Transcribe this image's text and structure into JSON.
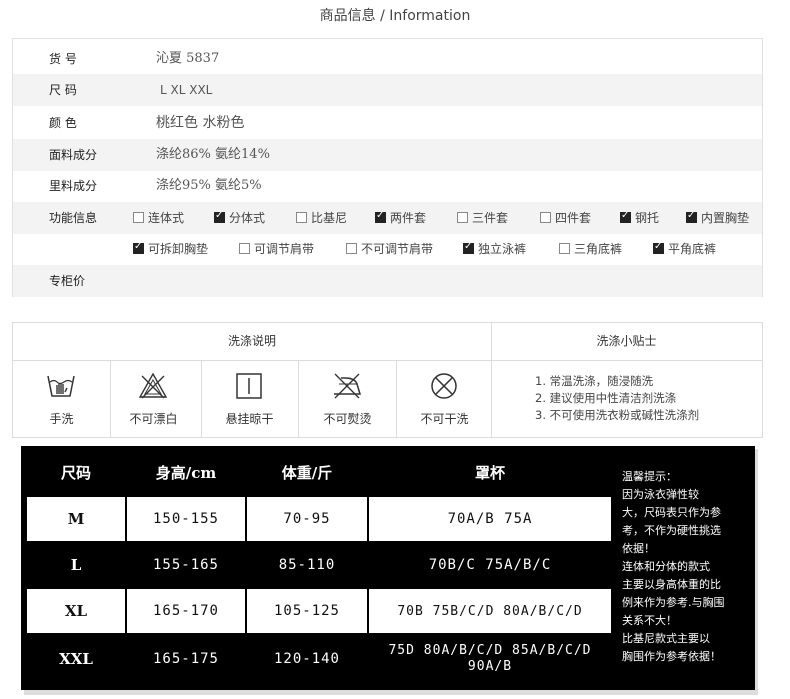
{
  "title": "商品信息 / Information",
  "info": {
    "item_no_label": "货  号",
    "item_no": "沁夏 5837",
    "size_label": "尺  码",
    "sizes": "L    XL    XXL",
    "color_label": "颜  色",
    "colors": "桃红色   水粉色",
    "fabric_label": "面料成分",
    "fabric": "涤纶86%  氨纶14%",
    "lining_label": "里料成分",
    "lining": "涤纶95%  氨纶5%",
    "function_label": "功能信息",
    "functions_row1": [
      {
        "label": "连体式",
        "checked": false
      },
      {
        "label": "分体式",
        "checked": true
      },
      {
        "label": "比基尼",
        "checked": false
      },
      {
        "label": "两件套",
        "checked": true
      },
      {
        "label": "三件套",
        "checked": false
      },
      {
        "label": "四件套",
        "checked": false
      },
      {
        "label": "钢托",
        "checked": true
      },
      {
        "label": "内置胸垫",
        "checked": true
      }
    ],
    "functions_row2": [
      {
        "label": "可拆卸胸垫",
        "checked": true
      },
      {
        "label": "可调节肩带",
        "checked": false
      },
      {
        "label": "不可调节肩带",
        "checked": false
      },
      {
        "label": "独立泳裤",
        "checked": true
      },
      {
        "label": "三角底裤",
        "checked": false
      },
      {
        "label": "平角底裤",
        "checked": true
      }
    ],
    "price_label": "专柜价"
  },
  "wash": {
    "header_left": "洗涤说明",
    "header_right": "洗涤小贴士",
    "icons": [
      {
        "icon": "hand-wash-icon",
        "label": "手洗"
      },
      {
        "icon": "no-bleach-icon",
        "label": "不可漂白"
      },
      {
        "icon": "hang-dry-icon",
        "label": "悬挂晾干"
      },
      {
        "icon": "no-iron-icon",
        "label": "不可熨烫"
      },
      {
        "icon": "no-dry-clean-icon",
        "label": "不可干洗"
      }
    ],
    "tips": [
      "1.  常温洗涤，随浸随洗",
      "2.  建议使用中性清洁剂洗涤",
      "3.  不可使用洗衣粉或碱性洗涤剂"
    ]
  },
  "size_table": {
    "headers": [
      "尺码",
      "身高/cm",
      "体重/斤",
      "罩杯"
    ],
    "rows": [
      {
        "size": "M",
        "height": "150-155",
        "weight": "70-95",
        "cup": "70A/B  75A"
      },
      {
        "size": "L",
        "height": "155-165",
        "weight": "85-110",
        "cup": "70B/C  75A/B/C"
      },
      {
        "size": "XL",
        "height": "165-170",
        "weight": "105-125",
        "cup": "70B  75B/C/D  80A/B/C/D"
      },
      {
        "size": "XXL",
        "height": "165-175",
        "weight": "120-140",
        "cup": "75D  80A/B/C/D  85A/B/C/D 90A/B"
      }
    ],
    "note_title": "温馨提示：",
    "note_lines": [
      "    因为泳衣弹性较",
      "大，尺码表只作为参",
      "考，不作为硬性挑选",
      "依据！",
      "    连体和分体的款式",
      "主要以身高体重的比",
      "例来作为参考.与胸围",
      "关系不大！",
      "    比基尼款式主要以",
      "胸围作为参考依据！"
    ]
  }
}
